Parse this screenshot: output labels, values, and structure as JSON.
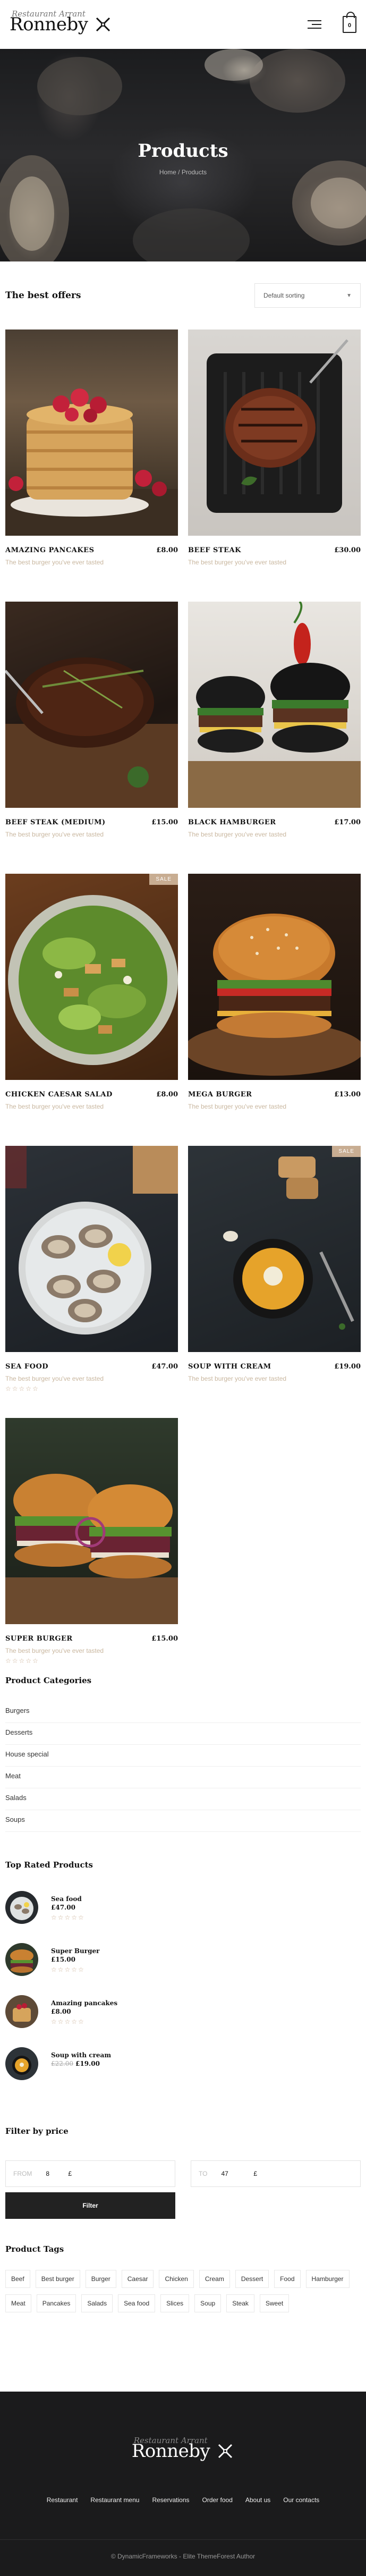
{
  "brand": {
    "script": "Restaurant Arrant",
    "name": "Ronneby"
  },
  "header": {
    "cart_count": "0",
    "menu_icon": "hamburger-menu-icon",
    "cart_icon": "shopping-bag-icon"
  },
  "hero": {
    "title": "Products",
    "breadcrumb": "Home / Products"
  },
  "offers": {
    "title": "The best offers",
    "sort_value": "Default sorting"
  },
  "products": [
    {
      "name": "Amazing pancakes",
      "price": "£8.00",
      "desc": "The best burger you've ever tasted",
      "sale": "",
      "rating": ""
    },
    {
      "name": "Beef steak",
      "price": "£30.00",
      "desc": "The best burger you've ever tasted",
      "sale": "",
      "rating": ""
    },
    {
      "name": "Beef steak (medium)",
      "price": "£15.00",
      "desc": "The best burger you've ever tasted",
      "sale": "",
      "rating": ""
    },
    {
      "name": "Black hamburger",
      "price": "£17.00",
      "desc": "The best burger you've ever tasted",
      "sale": "",
      "rating": ""
    },
    {
      "name": "Chicken Caesar salad",
      "price": "£8.00",
      "desc": "The best burger you've ever tasted",
      "sale": "SALE",
      "rating": ""
    },
    {
      "name": "Mega burger",
      "price": "£13.00",
      "desc": "The best burger you've ever tasted",
      "sale": "",
      "rating": ""
    },
    {
      "name": "Sea food",
      "price": "£47.00",
      "desc": "The best burger you've ever tasted",
      "sale": "",
      "rating": "☆☆☆☆☆"
    },
    {
      "name": "Soup with cream",
      "price": "£19.00",
      "desc": "The best burger you've ever tasted",
      "sale": "SALE",
      "rating": ""
    },
    {
      "name": "Super burger",
      "price": "£15.00",
      "desc": "The best burger you've ever tasted",
      "sale": "",
      "rating": "☆☆☆☆☆"
    }
  ],
  "categories": {
    "title": "Product Categories",
    "items": [
      "Burgers",
      "Desserts",
      "House special",
      "Meat",
      "Salads",
      "Soups"
    ]
  },
  "top_rated": {
    "title": "Top Rated Products",
    "items": [
      {
        "name": "Sea food",
        "price": "£47.00",
        "old_price": "",
        "rating": "☆☆☆☆☆"
      },
      {
        "name": "Super Burger",
        "price": "£15.00",
        "old_price": "",
        "rating": "☆☆☆☆☆"
      },
      {
        "name": "Amazing pancakes",
        "price": "£8.00",
        "old_price": "",
        "rating": "☆☆☆☆☆"
      },
      {
        "name": "Soup with cream",
        "price": "£19.00",
        "old_price": "£22.00",
        "rating": ""
      }
    ]
  },
  "price_filter": {
    "title": "Filter by price",
    "from_label": "FROM",
    "from_value": "8",
    "to_label": "TO",
    "to_value": "47",
    "currency": "£",
    "button": "Filter"
  },
  "tags": {
    "title": "Product Tags",
    "items": [
      "Beef",
      "Best burger",
      "Burger",
      "Caesar",
      "Chicken",
      "Cream",
      "Dessert",
      "Food",
      "Hamburger",
      "Meat",
      "Pancakes",
      "Salads",
      "Sea food",
      "Slices",
      "Soup",
      "Steak",
      "Sweet"
    ]
  },
  "footer": {
    "nav": [
      "Restaurant",
      "Restaurant menu",
      "Reservations",
      "Order food",
      "About us",
      "Our contacts"
    ],
    "copyright": "© DynamicFrameworks - Elite ThemeForest Author"
  }
}
